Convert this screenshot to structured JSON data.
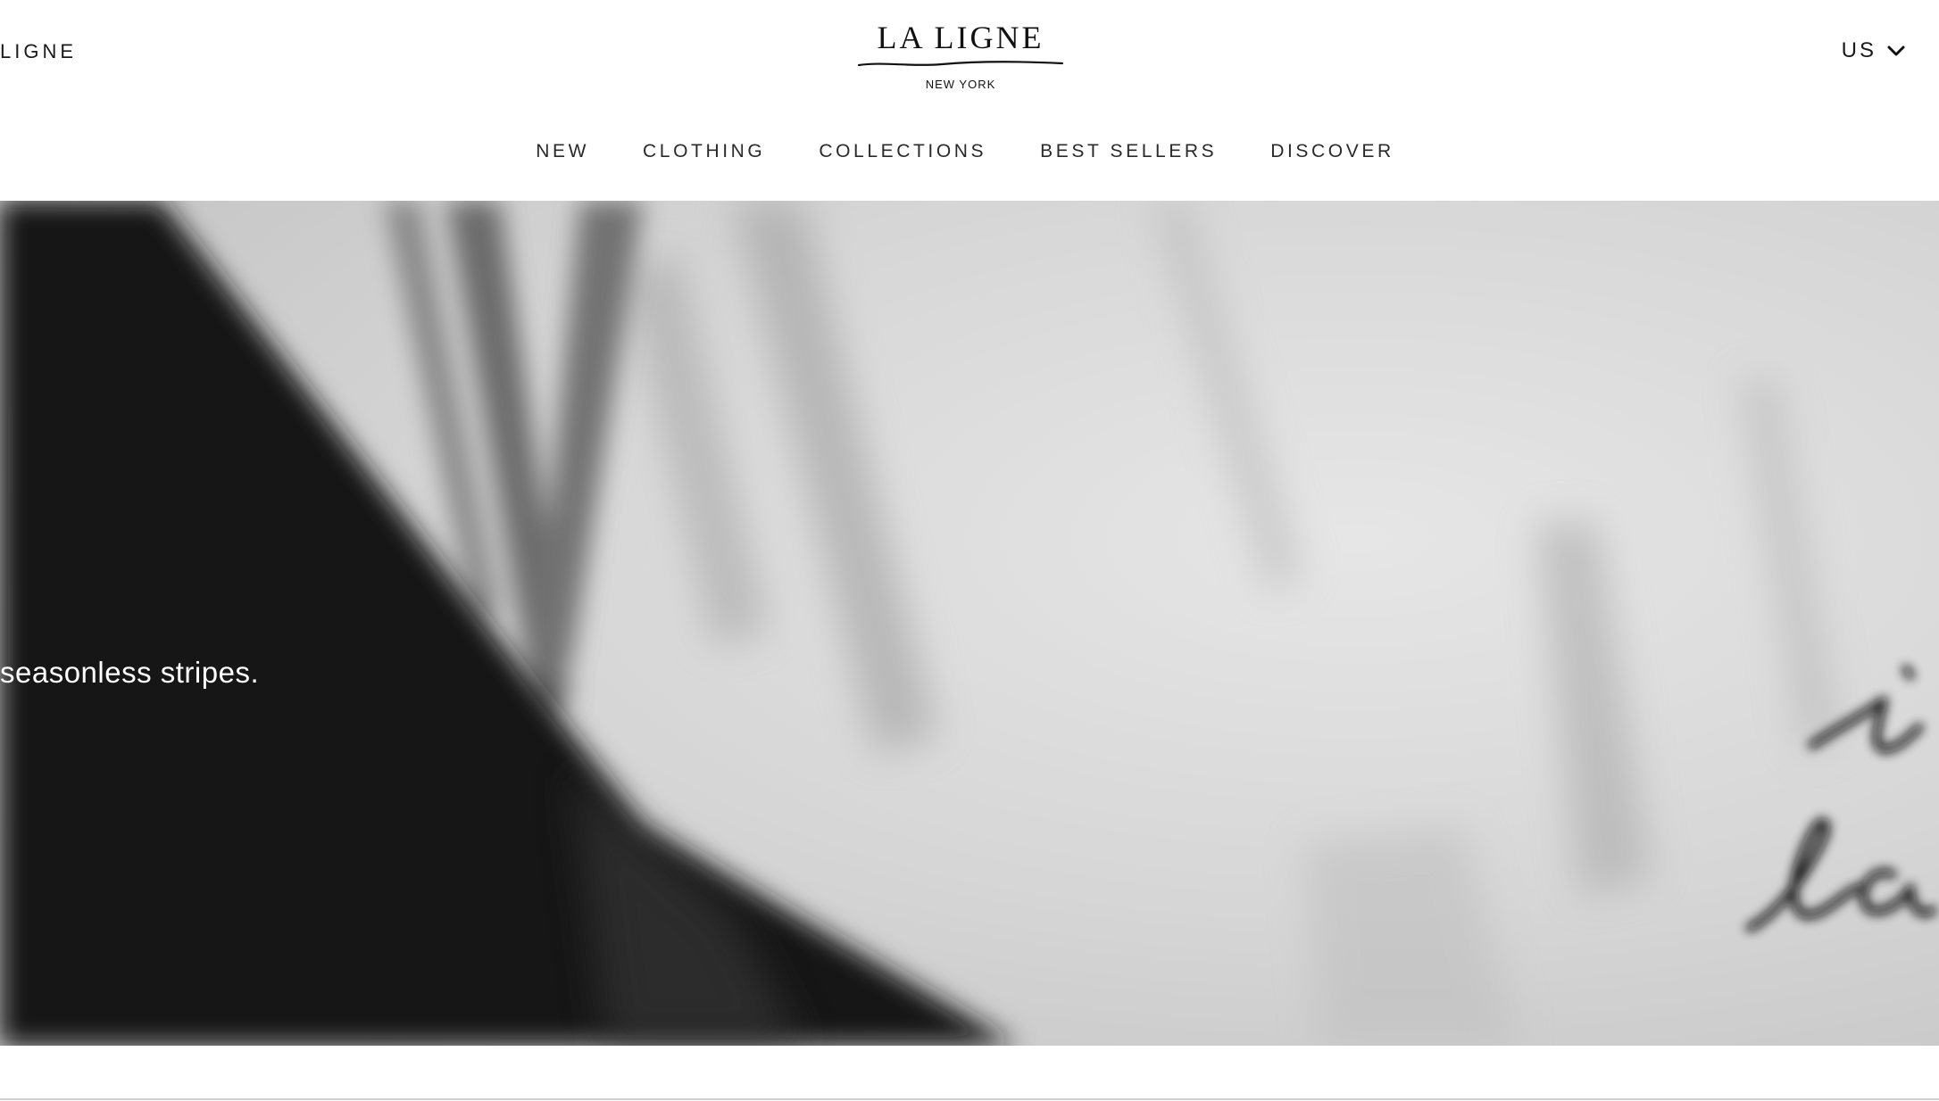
{
  "header": {
    "left_link": "LIGNE",
    "logo": {
      "main": "LA LIGNE",
      "sub": "NEW YORK"
    },
    "region": {
      "label": "US",
      "icon": "chevron-down-icon"
    }
  },
  "nav": {
    "items": [
      {
        "label": "NEW"
      },
      {
        "label": "CLOTHING"
      },
      {
        "label": "COLLECTIONS"
      },
      {
        "label": "BEST SELLERS"
      },
      {
        "label": "DISCOVER"
      }
    ]
  },
  "hero": {
    "caption": "seasonless stripes.",
    "embroidery_lines": [
      "i",
      "la"
    ]
  },
  "colors": {
    "text": "#1a1a1a",
    "hero_dark": "#161616",
    "hero_light": "#d9d9d9",
    "hero_caption": "#ffffff",
    "divider": "#cfcfcf"
  }
}
